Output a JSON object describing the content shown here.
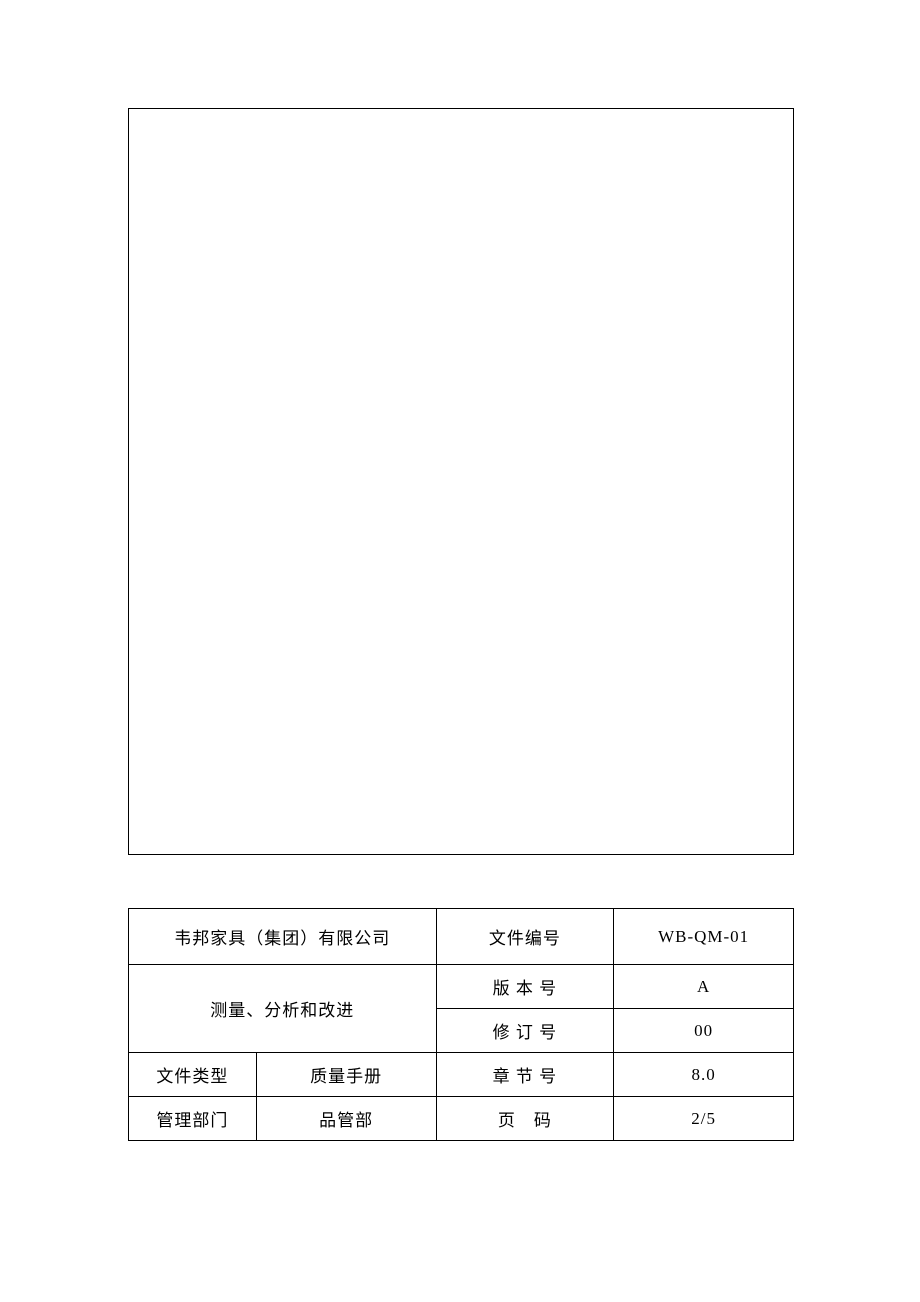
{
  "document": {
    "company": "韦邦家具（集团）有限公司",
    "title": "测量、分析和改进",
    "fields": {
      "doc_number_label": "文件编号",
      "doc_number_value": "WB-QM-01",
      "version_label": "版 本 号",
      "version_value": "A",
      "revision_label": "修 订 号",
      "revision_value": "00",
      "doc_type_label": "文件类型",
      "doc_type_value": "质量手册",
      "section_label": "章 节 号",
      "section_value": "8.0",
      "dept_label": "管理部门",
      "dept_value": "品管部",
      "page_label": "页　码",
      "page_value": "2/5"
    }
  }
}
